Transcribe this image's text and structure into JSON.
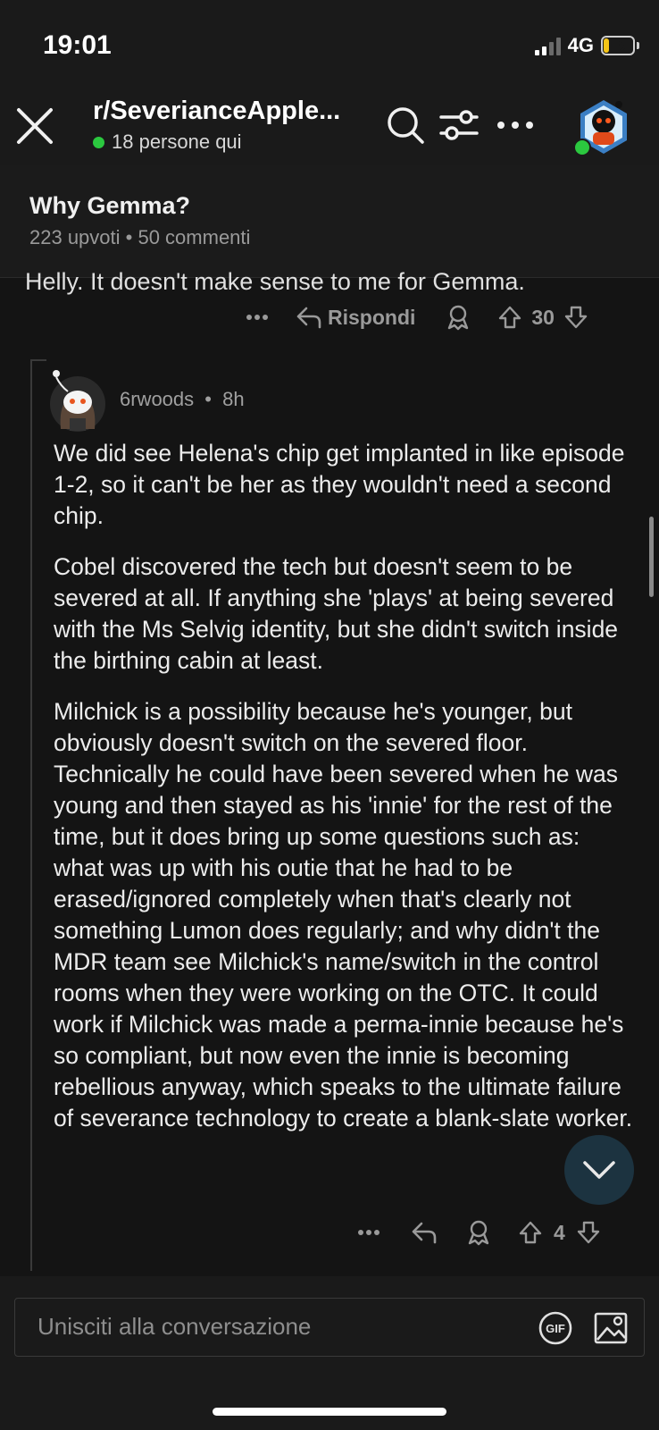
{
  "status_bar": {
    "time": "19:01",
    "network": "4G",
    "battery": "18",
    "battery_level": 0.18
  },
  "header": {
    "title": "r/SeverianceApple...",
    "online": "18 persone qui"
  },
  "post": {
    "title": "Why Gemma?",
    "upvotes": "223 upvoti",
    "separator": " • ",
    "comments": "50 commenti"
  },
  "parent_comment": {
    "text_cut": "Helly.  It doesn't make sense to me for Gemma.",
    "reply_label": "Rispondi",
    "votes": "30"
  },
  "comment": {
    "author": "6rwoods",
    "separator": "•",
    "time": "8h",
    "paragraphs": [
      "We did see Helena's chip get implanted in like episode 1-2, so it can't be her as they wouldn't need a second chip.",
      "Cobel discovered the tech but doesn't seem to be severed at all. If anything she 'plays' at being severed with the Ms Selvig identity, but she didn't switch inside the birthing cabin at least.",
      "Milchick is a possibility because he's younger, but obviously doesn't switch on the severed floor. Technically he could have been severed when he was young and then stayed as his 'innie' for the rest of the time, but it does bring up some questions such as: what was up with his outie that he had to be erased/ignored completely when that's clearly not something Lumon does regularly; and why didn't the MDR team see Milchick's name/switch in the control rooms when they were working on the OTC. It could work if Milchick was made a perma-innie because he's so compliant, but now even the innie is becoming rebellious anyway, which speaks to the ultimate failure of severance technology to create a blank-slate worker."
    ],
    "votes": "4"
  },
  "composer": {
    "placeholder": "Unisciti alla conversazione",
    "gif_label": "GIF"
  },
  "colors": {
    "background": "#141414",
    "online_dot": "#2bc83f",
    "battery": "#f5c518",
    "fab": "#1c3340"
  }
}
